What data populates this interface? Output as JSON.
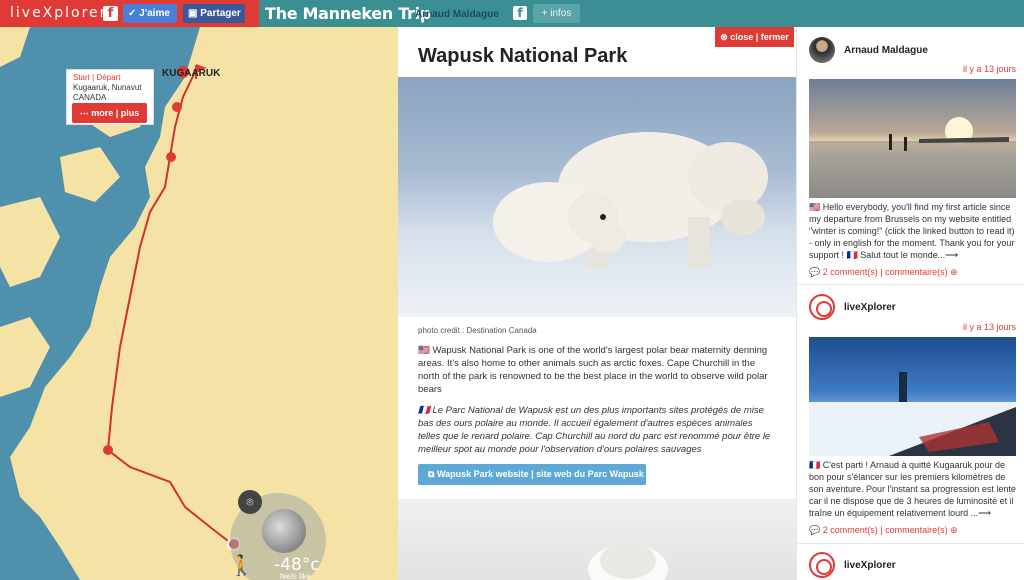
{
  "topbar": {
    "brand": "liveXplorer",
    "fb_icon": "f",
    "like_label": "J'aime",
    "share_label": "Partager",
    "trip_title": "The Manneken Trip",
    "author": "Arnaud Maldague",
    "infos_label": "+ infos",
    "colors": {
      "brand_red": "#e03a34",
      "teal": "#3b8f93"
    }
  },
  "map": {
    "place_label": "KUGAARUK",
    "popup": {
      "start_label": "Start | Départ",
      "place": "Kugaaruk, Nunavut",
      "country": "CANADA",
      "more_label": "more | plus"
    },
    "weather": {
      "temperature": "-48°c",
      "feels_label": "feels like"
    },
    "icons": [
      "map-pin-icon",
      "hiker-icon",
      "moon-icon"
    ]
  },
  "article": {
    "close_label": "close | fermer",
    "title": "Wapusk National Park",
    "photo_credit": "photo credit : Destination Canada",
    "para_en": "🇺🇸 Wapusk National Park is one of the world's largest polar bear maternity denning areas. It's also home to other animals such as arctic foxes. Cape Churchill in the north of the park is renowned to be the best place in the world to observe wild polar bears",
    "para_fr": "🇫🇷 Le Parc National de Wapusk est un des plus importants sites protégés de mise bas des ours polaire au monde. Il accueil également d'autres espèces animales telles que le renard polaire. Cap Churchill au nord du parc est renommé pour être le meilleur spot au monde pour l'observation d'ours polaires sauvages",
    "website_label": "Wapusk Park website | site web du Parc Wapusk"
  },
  "feed": {
    "posts": [
      {
        "author": "Arnaud Maldague",
        "time": "il y a 13 jours",
        "text": "🇺🇸 Hello everybody, you'll find my first article since my departure from Brussels on my website entitled \"winter is coming!\" (click the linked button to read it) - only in english for the moment. Thank you for your support ! 🇫🇷 Salut tout le monde...⟶",
        "comments": "2 comment(s) | commentaire(s)"
      },
      {
        "author": "liveXplorer",
        "time": "il y a 13 jours",
        "text": "🇫🇷 C'est parti ! Arnaud à quitté Kugaaruk pour de bon pour s'élancer sur les premiers kilomètres de son aventure. Pour l'instant sa progression est lente car il ne dispose que de 3 heures de luminosité et il traîne un équipement relativement lourd ...⟶",
        "comments": "2 comment(s) | commentaire(s)"
      },
      {
        "author": "liveXplorer",
        "time": "",
        "text": "",
        "comments": ""
      }
    ]
  }
}
